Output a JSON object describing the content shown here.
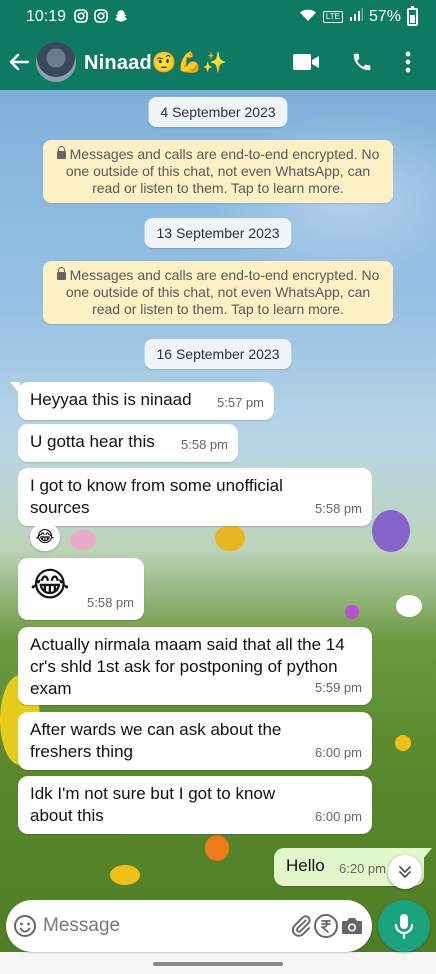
{
  "status_bar": {
    "time": "10:19",
    "battery": "57%",
    "network": "LTE",
    "icons": [
      "instagram-icon",
      "instagram-icon",
      "snapchat-icon",
      "wifi-icon",
      "signal-icon",
      "battery-icon"
    ]
  },
  "header": {
    "contact_name": "Ninaad🤨💪✨",
    "actions": [
      "video-call-icon",
      "voice-call-icon",
      "more-options-icon"
    ]
  },
  "chat": {
    "date_1": "4 September 2023",
    "encryption_note_1": "Messages and calls are end-to-end encrypted. No one outside of this chat, not even WhatsApp, can read or listen to them. Tap to learn more.",
    "date_2": "13 September 2023",
    "encryption_note_2": "Messages and calls are end-to-end encrypted. No one outside of this chat, not even WhatsApp, can read or listen to them. Tap to learn more.",
    "date_3": "16 September 2023",
    "messages": [
      {
        "text": "Heyyaa this is ninaad",
        "time": "5:57 pm",
        "direction": "in"
      },
      {
        "text": "U gotta hear this",
        "time": "5:58 pm",
        "direction": "in"
      },
      {
        "text": "I got to know from some unofficial sources",
        "time": "5:58 pm",
        "direction": "in",
        "reaction": "😂"
      },
      {
        "text": "😂",
        "time": "5:58 pm",
        "direction": "in"
      },
      {
        "text": "Actually nirmala maam said that all the 14 cr's shld 1st ask for postponing of python exam",
        "time": "5:59 pm",
        "direction": "in"
      },
      {
        "text": "After wards we can ask about the freshers thing",
        "time": "6:00 pm",
        "direction": "in"
      },
      {
        "text": "Idk I'm not sure but I got to know about this",
        "time": "6:00 pm",
        "direction": "in"
      },
      {
        "text": "Hello",
        "time": "6:20 pm",
        "direction": "out"
      }
    ]
  },
  "input_bar": {
    "placeholder": "Message",
    "icons": [
      "emoji-icon",
      "attach-icon",
      "rupee-payment-icon",
      "camera-icon",
      "mic-icon"
    ]
  },
  "colors": {
    "header": "#0e7a63",
    "incoming_bubble": "#ffffff",
    "outgoing_bubble": "#e1f7cb",
    "encryption_note": "#fdf0c4",
    "mic_button": "#1aa37e"
  }
}
